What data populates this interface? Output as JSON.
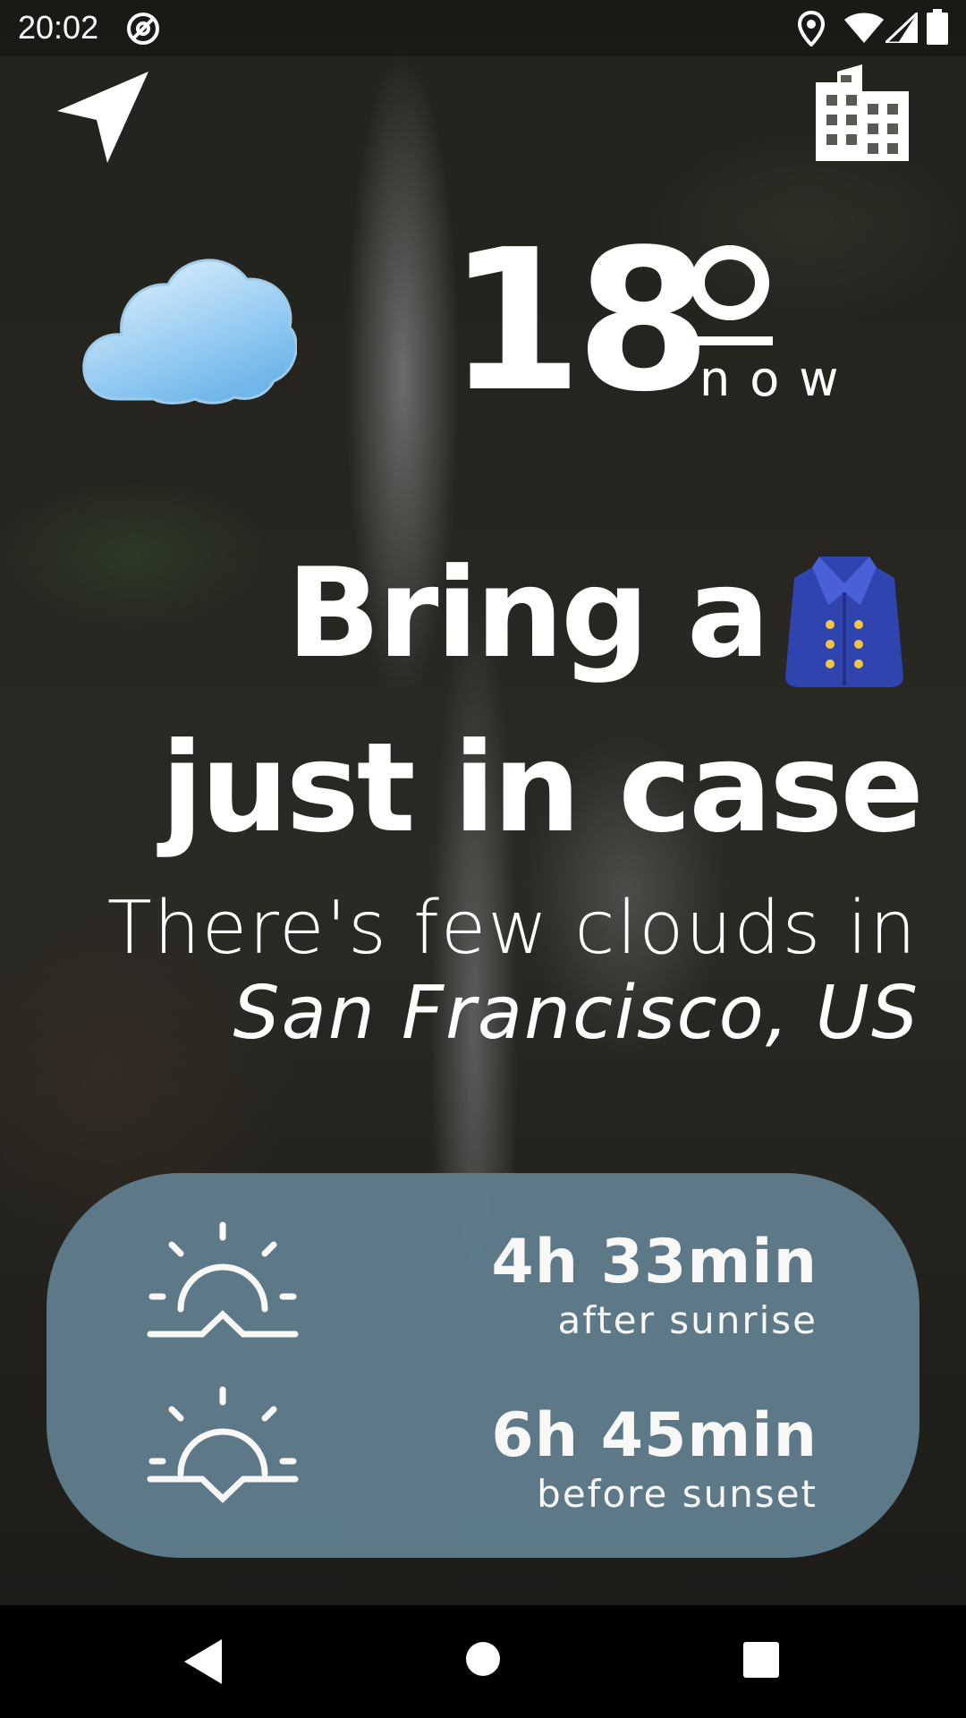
{
  "status_bar": {
    "time": "20:02",
    "icons": [
      "at-sign-icon",
      "location-pin-icon",
      "wifi-icon",
      "cell-signal-icon",
      "battery-icon"
    ]
  },
  "toolbar": {
    "left_icon": "navigation-arrow-icon",
    "right_icon": "city-buildings-icon"
  },
  "weather": {
    "condition_icon": "cloud-icon",
    "temperature": "18",
    "degree_unit": "º",
    "now_label": "now",
    "headline_line1": "Bring a",
    "headline_icon": "coat-icon",
    "headline_line2": "just in case",
    "description_line1": "There's few clouds in",
    "location": "San Francisco, US"
  },
  "sun_card": {
    "background_color": "#5f7c8b",
    "sunrise": {
      "icon": "sunrise-icon",
      "value": "4h 33min",
      "caption": "after sunrise"
    },
    "sunset": {
      "icon": "sunset-icon",
      "value": "6h 45min",
      "caption": "before sunset"
    }
  },
  "nav_bar": {
    "buttons": [
      "back-icon",
      "home-icon",
      "recents-icon"
    ]
  }
}
